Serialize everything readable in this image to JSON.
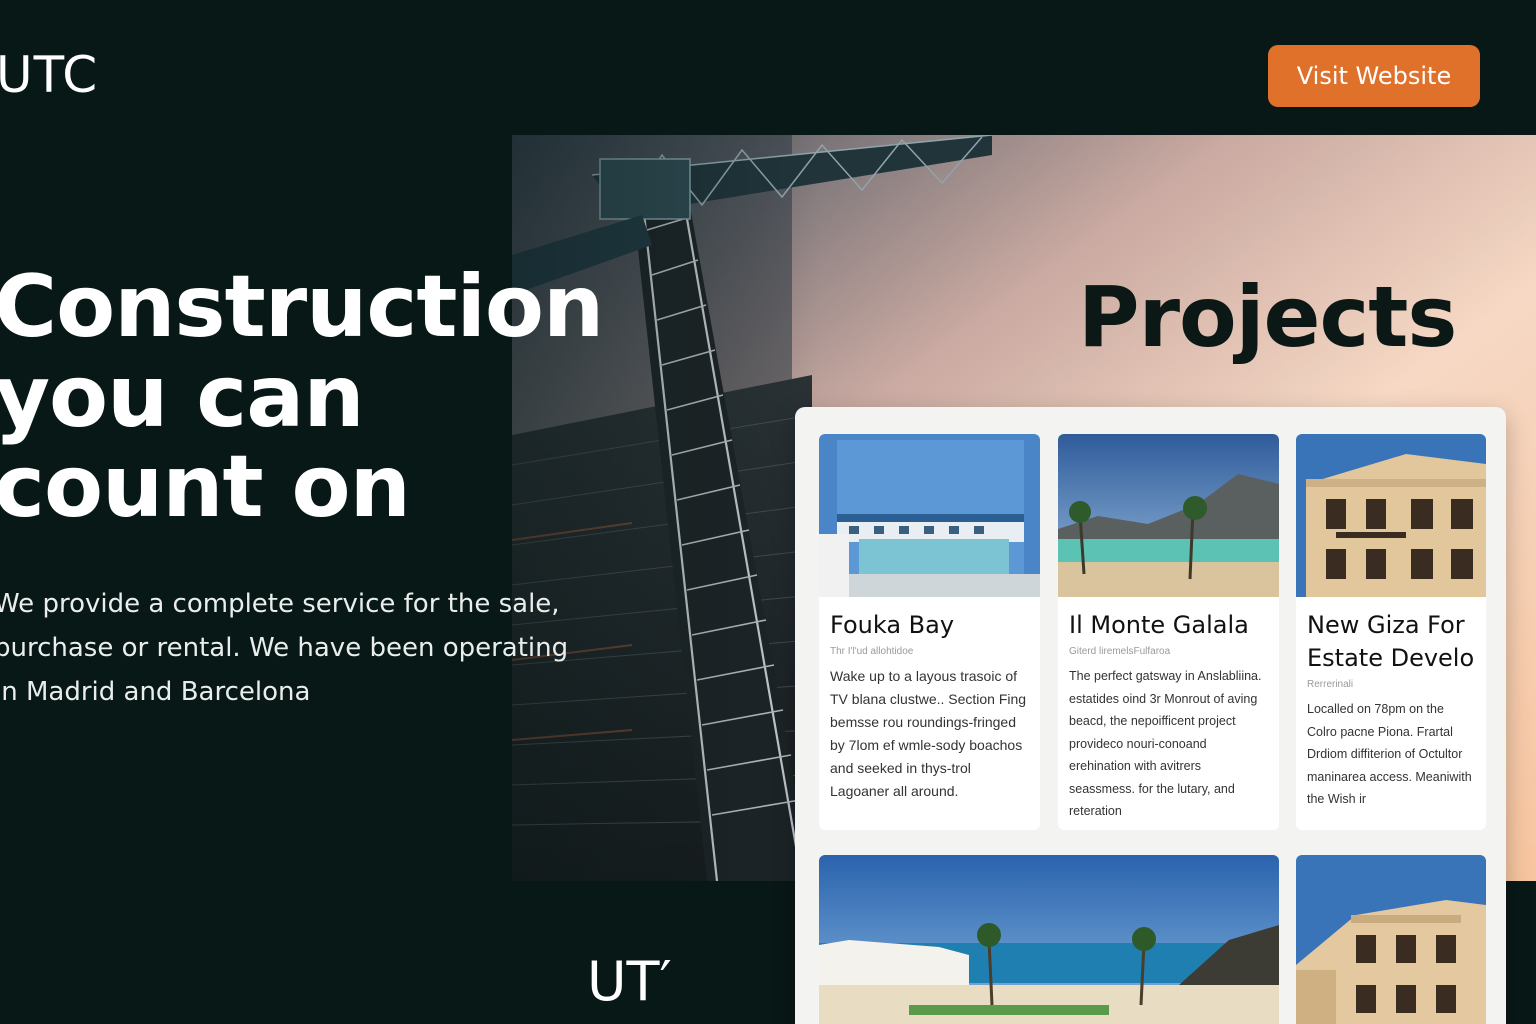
{
  "header": {
    "logo": "UTC",
    "cta_label": "Visit Website"
  },
  "colors": {
    "background": "#081817",
    "accent": "#e0712b",
    "card_bg": "#ffffff"
  },
  "hero": {
    "title_lines": [
      "Construction",
      "you can",
      "count on"
    ],
    "copy_lines": [
      "We provide a complete service for the sale,",
      "purchase or rental. We have been operating",
      "in Madrid and Barcelona"
    ]
  },
  "projects": {
    "title": "Projects",
    "cards": [
      {
        "title": "Fouka Bay",
        "subtitle": "Thr I'l'ud allohtidoe",
        "description": "Wake up to a layous trasoic of TV blana clustwe.. Section Fing bemsse rou roundings-fringed by 7lom ef wmle-sody boachos and seeked in thys-trol Lagoaner all around.",
        "image": "pool-resort-photo"
      },
      {
        "title": "Il Monte Galala",
        "subtitle": "Giterd liremelsFulfaroa",
        "description": "The perfect gatsway in Anslabliina. estatides oind 3r Monrout of aving beacd, the nepoifficent project provideco nouri-conoand erehination with avitrers seassmess. for the lutary, and reteration",
        "image": "lagoon-mountain-photo"
      },
      {
        "title": "New Giza For Estate Develo",
        "subtitle": "Rerrerinali",
        "description": "Localled on 78pm on the Colro pacne Piona. Frartal Drdiom diffiterion of Octultor maninarea access. Meaniwith the Wish ir",
        "image": "villa-facade-photo"
      }
    ],
    "bottom_images": [
      "beach-resort-photo",
      "villa-facade-photo"
    ]
  },
  "footer": {
    "logo": "UT′"
  }
}
